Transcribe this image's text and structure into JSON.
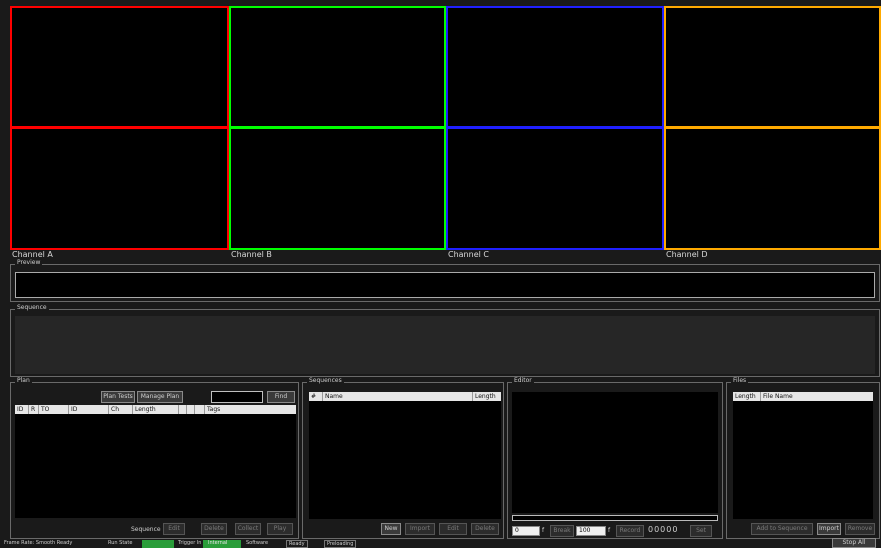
{
  "channels": [
    {
      "label": "Channel A",
      "color": "#ff0000"
    },
    {
      "label": "Channel B",
      "color": "#00ff00"
    },
    {
      "label": "Channel C",
      "color": "#2020ff"
    },
    {
      "label": "Channel D",
      "color": "#ffaa00"
    }
  ],
  "preview": {
    "title": "Preview"
  },
  "sequence_view": {
    "title": "Sequence"
  },
  "plan": {
    "title": "Plan",
    "buttons": [
      "Plan Tests",
      "Manage Plan",
      "Find"
    ],
    "columns": [
      "ID",
      "R",
      "TO",
      "ID",
      "Ch",
      "Length",
      "",
      "",
      "",
      "Tags"
    ],
    "footer_label": "Sequence",
    "footer_buttons": [
      "Edit",
      "Delete",
      "Collect",
      "Play"
    ]
  },
  "sequences": {
    "title": "Sequences",
    "columns": [
      "#",
      "Name",
      "Length"
    ],
    "buttons": [
      "New",
      "Import",
      "Edit",
      "Delete"
    ]
  },
  "editor": {
    "title": "Editor",
    "spin1": "0",
    "spin1_unit": "f",
    "btn_mid": "Break",
    "spin2": "100",
    "spin2_unit": "f",
    "btn_right": "Record",
    "counter": "00000",
    "btn_end": "Set"
  },
  "files": {
    "title": "Files",
    "columns": [
      "Length",
      "File Name"
    ],
    "buttons": [
      "Add to Sequence",
      "Import",
      "Remove"
    ]
  },
  "statusbar": {
    "left_text": "Frame Rate: Smooth  Ready",
    "run_state_label": "Run State",
    "trigger_label": "Trigger In",
    "trigger_value": "Internal",
    "software_label": "Software",
    "status": "Ready",
    "mode": "Preloading",
    "stop_button": "Stop All"
  }
}
